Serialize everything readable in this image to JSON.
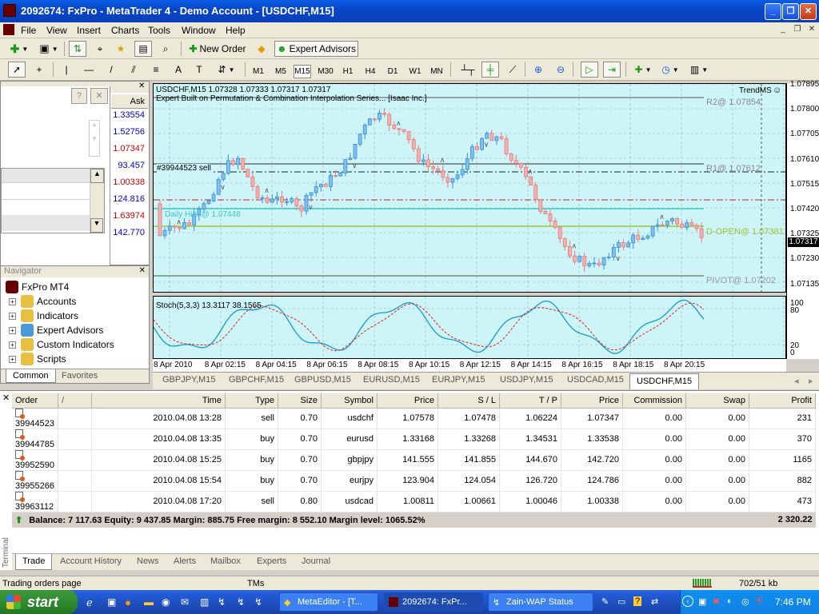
{
  "window": {
    "title": "2092674: FxPro - MetaTrader 4 - Demo Account - [USDCHF,M15]"
  },
  "menu": [
    "File",
    "View",
    "Insert",
    "Charts",
    "Tools",
    "Window",
    "Help"
  ],
  "toolbar": {
    "new_order": "New Order",
    "expert_advisors": "Expert Advisors"
  },
  "periods": [
    "M1",
    "M5",
    "M15",
    "M30",
    "H1",
    "H4",
    "D1",
    "W1",
    "MN"
  ],
  "active_period": "M15",
  "market_watch": {
    "header": "Ask",
    "asks": [
      {
        "value": "1.33554",
        "color": "#0000cc"
      },
      {
        "value": "1.52756",
        "color": "#0000cc"
      },
      {
        "value": "1.07347",
        "color": "#cc0000"
      },
      {
        "value": "93.457",
        "color": "#0000cc"
      },
      {
        "value": "1.00338",
        "color": "#cc0000"
      },
      {
        "value": "124.816",
        "color": "#0000cc"
      },
      {
        "value": "1.63974",
        "color": "#cc0000"
      },
      {
        "value": "142.770",
        "color": "#0000cc"
      }
    ]
  },
  "navigator": {
    "title": "Navigator",
    "root": "FxPro MT4",
    "items": [
      "Accounts",
      "Indicators",
      "Expert Advisors",
      "Custom Indicators",
      "Scripts"
    ],
    "tabs": [
      "Common",
      "Favorites"
    ]
  },
  "chart": {
    "header": "USDCHF,M15  1.07328 1.07333 1.07317 1.07317",
    "expert_line": "Expert Built on Permutation & Combination Interpolation Series... [Isaac Inc.]",
    "trendms": "TrendMS",
    "order_label": "#39944523 sell",
    "r2": "R2@ 1.07854",
    "r1": "R1@ 1.07612",
    "daily_high": "Daily High@ 1.07448",
    "d_open": "D-OPEN@ 1.07381",
    "pivot": "PIVOT@ 1.07202",
    "price_labels": [
      "1.07895",
      "1.07800",
      "1.07705",
      "1.07610",
      "1.07515",
      "1.07420",
      "1.07325",
      "1.07230",
      "1.07135"
    ],
    "current_price": "1.07317",
    "stoch_label": "Stoch(5,3,3) 13.3117 38.1565",
    "stoch_levels": [
      "100",
      "80",
      "20",
      "0"
    ],
    "time_labels": [
      "8 Apr 2010",
      "8 Apr 02:15",
      "8 Apr 04:15",
      "8 Apr 06:15",
      "8 Apr 08:15",
      "8 Apr 10:15",
      "8 Apr 12:15",
      "8 Apr 14:15",
      "8 Apr 16:15",
      "8 Apr 18:15",
      "8 Apr 20:15"
    ]
  },
  "chart_tabs": [
    "GBPJPY,M15",
    "GBPCHF,M15",
    "GBPUSD,M15",
    "EURUSD,M15",
    "EURJPY,M15",
    "USDJPY,M15",
    "USDCAD,M15",
    "USDCHF,M15"
  ],
  "active_chart_tab": "USDCHF,M15",
  "terminal": {
    "side_label": "Terminal",
    "columns": [
      "Order",
      "/",
      "Time",
      "Type",
      "Size",
      "Symbol",
      "Price",
      "S / L",
      "T / P",
      "Price",
      "Commission",
      "Swap",
      "Profit"
    ],
    "orders": [
      {
        "order": "39944523",
        "time": "2010.04.08 13:28",
        "type": "sell",
        "size": "0.70",
        "symbol": "usdchf",
        "price": "1.07578",
        "sl": "1.07478",
        "tp": "1.06224",
        "cur": "1.07347",
        "commission": "0.00",
        "swap": "0.00",
        "profit": "231"
      },
      {
        "order": "39944785",
        "time": "2010.04.08 13:35",
        "type": "buy",
        "size": "0.70",
        "symbol": "eurusd",
        "price": "1.33168",
        "sl": "1.33268",
        "tp": "1.34531",
        "cur": "1.33538",
        "commission": "0.00",
        "swap": "0.00",
        "profit": "370"
      },
      {
        "order": "39952590",
        "time": "2010.04.08 15:25",
        "type": "buy",
        "size": "0.70",
        "symbol": "gbpjpy",
        "price": "141.555",
        "sl": "141.855",
        "tp": "144.670",
        "cur": "142.720",
        "commission": "0.00",
        "swap": "0.00",
        "profit": "1165"
      },
      {
        "order": "39955266",
        "time": "2010.04.08 15:54",
        "type": "buy",
        "size": "0.70",
        "symbol": "eurjpy",
        "price": "123.904",
        "sl": "124.054",
        "tp": "126.720",
        "cur": "124.786",
        "commission": "0.00",
        "swap": "0.00",
        "profit": "882"
      },
      {
        "order": "39963112",
        "time": "2010.04.08 17:20",
        "type": "sell",
        "size": "0.80",
        "symbol": "usdcad",
        "price": "1.00811",
        "sl": "1.00661",
        "tp": "1.00046",
        "cur": "1.00338",
        "commission": "0.00",
        "swap": "0.00",
        "profit": "473"
      }
    ],
    "balance_line": "Balance: 7 117.63  Equity: 9 437.85  Margin: 885.75  Free margin: 8 552.10  Margin level: 1065.52%",
    "total_profit": "2 320.22",
    "tabs": [
      "Trade",
      "Account History",
      "News",
      "Alerts",
      "Mailbox",
      "Experts",
      "Journal"
    ]
  },
  "status": {
    "left": "Trading orders page",
    "profile": "TMs",
    "traffic": "702/51 kb"
  },
  "taskbar": {
    "start": "start",
    "buttons": [
      "MetaEditor - [T...",
      "2092674: FxPr...",
      "Zain-WAP Status"
    ],
    "clock": "7:46 PM"
  },
  "colors": {
    "chart_bg": "#cdf4f7",
    "bull": "#3a8fd8",
    "bear": "#e87a7a"
  }
}
